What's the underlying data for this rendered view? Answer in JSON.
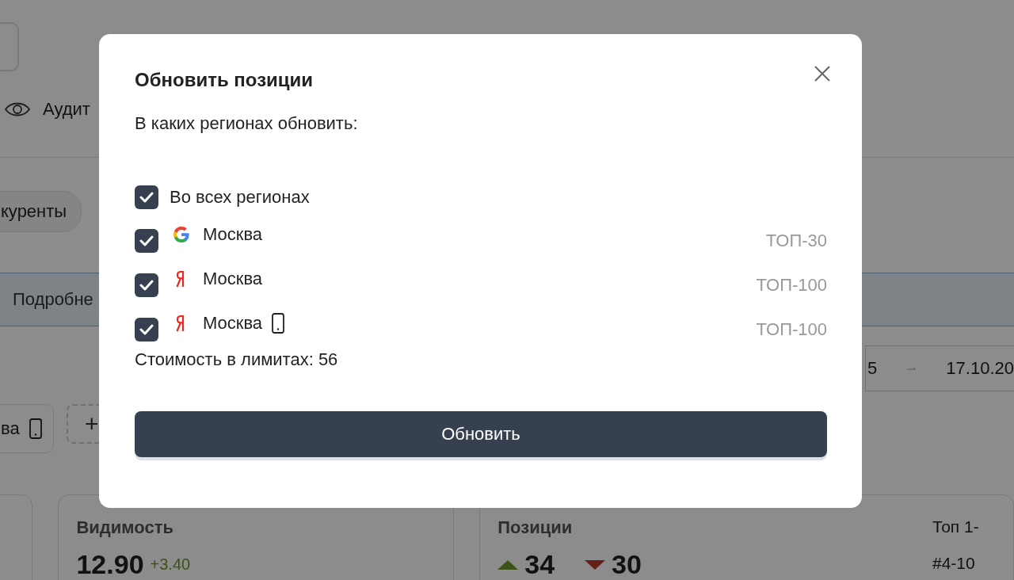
{
  "background": {
    "nav_item": "Аудит",
    "chip": "куренты",
    "banner_link": "Подробне",
    "date_start": "5",
    "date_end": "17.10.20",
    "region_chip": "ва",
    "add_chip": "+",
    "visibility_card": {
      "title": "Видимость",
      "value": "12.90",
      "delta": "+3.40"
    },
    "positions_card": {
      "title": "Позиции",
      "up": "34",
      "down": "30",
      "side": [
        "Топ 1-",
        "#4-10"
      ]
    }
  },
  "modal": {
    "title": "Обновить позиции",
    "prompt": "В каких регионах обновить:",
    "options": [
      {
        "kind": "all",
        "label": "Во всех регионах",
        "checked": true
      },
      {
        "kind": "google",
        "label": "Москва",
        "mobile": false,
        "depth": "ТОП-30",
        "checked": true
      },
      {
        "kind": "yandex",
        "label": "Москва",
        "mobile": false,
        "depth": "ТОП-100",
        "checked": true
      },
      {
        "kind": "yandex",
        "label": "Москва",
        "mobile": true,
        "depth": "ТОП-100",
        "checked": true
      }
    ],
    "cost": "Стоимость в лимитах: 56",
    "button": "Обновить"
  }
}
